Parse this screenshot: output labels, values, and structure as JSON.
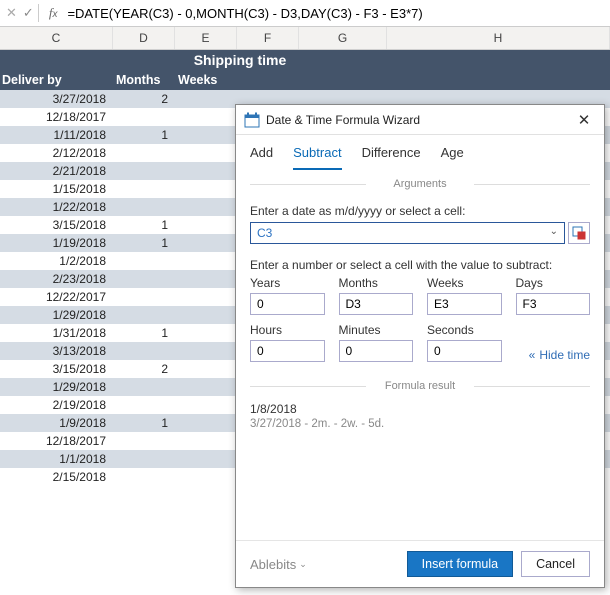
{
  "formula_bar": {
    "formula": "=DATE(YEAR(C3) - 0,MONTH(C3) - D3,DAY(C3) - F3 - E3*7)"
  },
  "columns": {
    "C": "C",
    "D": "D",
    "E": "E",
    "F": "F",
    "G": "G",
    "H": "H"
  },
  "headers": {
    "shipping_time": "Shipping time",
    "deliver_by": "Deliver by",
    "months": "Months",
    "weeks": "Weeks"
  },
  "rows": [
    {
      "deliver": "3/27/2018",
      "months": "2",
      "weeks": ""
    },
    {
      "deliver": "12/18/2017",
      "months": "",
      "weeks": ""
    },
    {
      "deliver": "1/11/2018",
      "months": "1",
      "weeks": ""
    },
    {
      "deliver": "2/12/2018",
      "months": "",
      "weeks": ""
    },
    {
      "deliver": "2/21/2018",
      "months": "",
      "weeks": ""
    },
    {
      "deliver": "1/15/2018",
      "months": "",
      "weeks": ""
    },
    {
      "deliver": "1/22/2018",
      "months": "",
      "weeks": ""
    },
    {
      "deliver": "3/15/2018",
      "months": "1",
      "weeks": ""
    },
    {
      "deliver": "1/19/2018",
      "months": "1",
      "weeks": ""
    },
    {
      "deliver": "1/2/2018",
      "months": "",
      "weeks": ""
    },
    {
      "deliver": "2/23/2018",
      "months": "",
      "weeks": ""
    },
    {
      "deliver": "12/22/2017",
      "months": "",
      "weeks": ""
    },
    {
      "deliver": "1/29/2018",
      "months": "",
      "weeks": ""
    },
    {
      "deliver": "1/31/2018",
      "months": "1",
      "weeks": ""
    },
    {
      "deliver": "3/13/2018",
      "months": "",
      "weeks": ""
    },
    {
      "deliver": "3/15/2018",
      "months": "2",
      "weeks": ""
    },
    {
      "deliver": "1/29/2018",
      "months": "",
      "weeks": ""
    },
    {
      "deliver": "2/19/2018",
      "months": "",
      "weeks": ""
    },
    {
      "deliver": "1/9/2018",
      "months": "1",
      "weeks": ""
    },
    {
      "deliver": "12/18/2017",
      "months": "",
      "weeks": ""
    },
    {
      "deliver": "1/1/2018",
      "months": "",
      "weeks": ""
    },
    {
      "deliver": "2/15/2018",
      "months": "",
      "weeks": ""
    }
  ],
  "dialog": {
    "title": "Date & Time Formula Wizard",
    "tabs": {
      "add": "Add",
      "subtract": "Subtract",
      "difference": "Difference",
      "age": "Age"
    },
    "section_arguments": "Arguments",
    "date_label": "Enter a date as m/d/yyyy or select a cell:",
    "date_value": "C3",
    "subtract_label": "Enter a number or select a cell with the value to subtract:",
    "labels": {
      "years": "Years",
      "months": "Months",
      "weeks": "Weeks",
      "days": "Days",
      "hours": "Hours",
      "minutes": "Minutes",
      "seconds": "Seconds"
    },
    "values": {
      "years": "0",
      "months": "D3",
      "weeks": "E3",
      "days": "F3",
      "hours": "0",
      "minutes": "0",
      "seconds": "0"
    },
    "hide_time": "Hide time",
    "section_result": "Formula result",
    "result_line1": "1/8/2018",
    "result_line2": "3/27/2018 - 2m. - 2w. - 5d.",
    "brand": "Ablebits",
    "insert": "Insert formula",
    "cancel": "Cancel"
  }
}
